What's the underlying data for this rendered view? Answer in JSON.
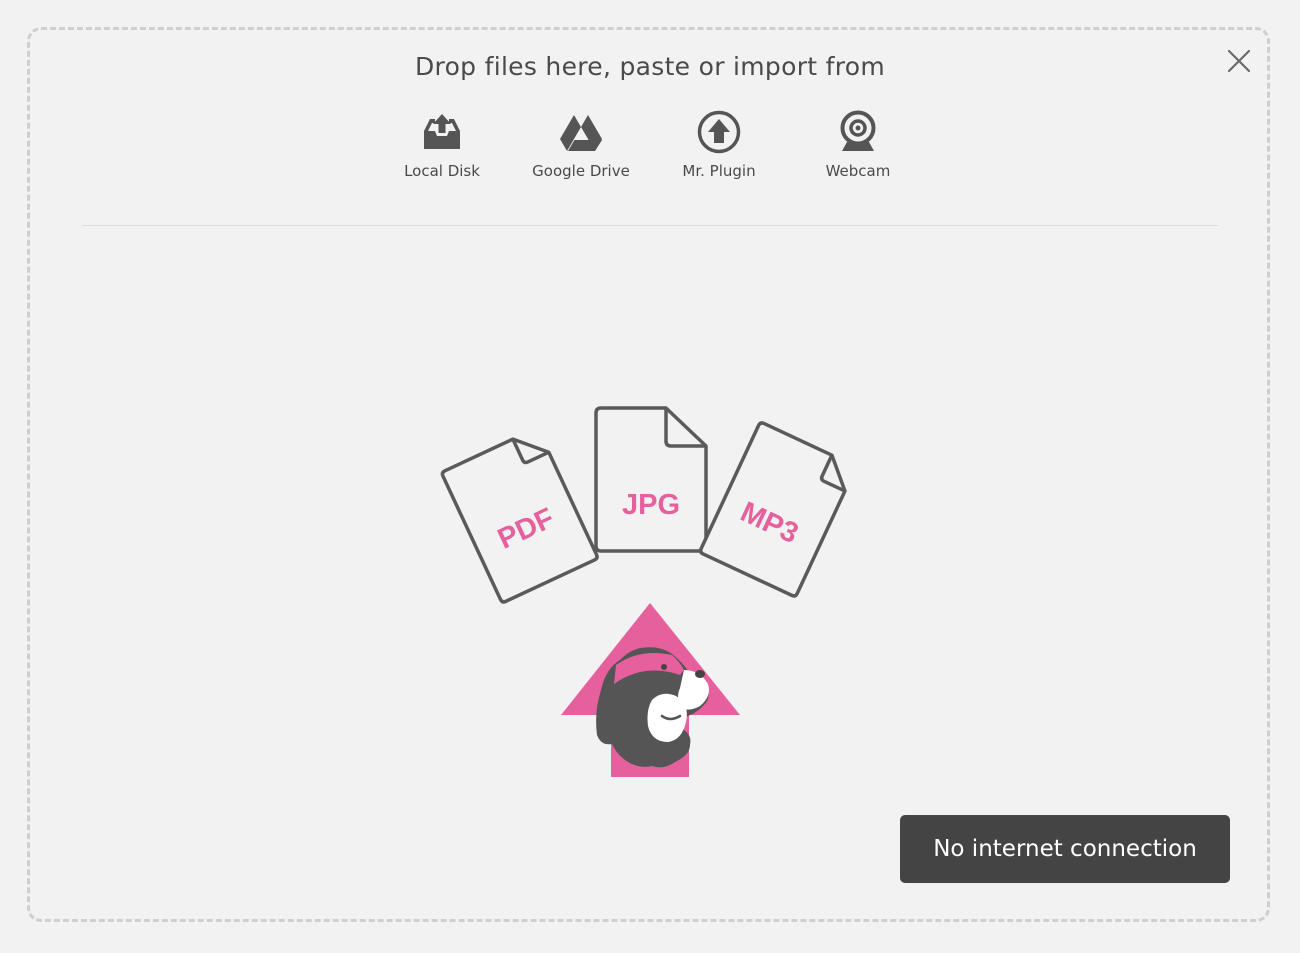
{
  "header": {
    "title": "Drop files here, paste or import from"
  },
  "sources": [
    {
      "label": "Local Disk",
      "icon": "inbox-upload-icon"
    },
    {
      "label": "Google Drive",
      "icon": "google-drive-icon"
    },
    {
      "label": "Mr. Plugin",
      "icon": "upload-circle-icon"
    },
    {
      "label": "Webcam",
      "icon": "webcam-icon"
    }
  ],
  "illustration": {
    "files": [
      "PDF",
      "JPG",
      "MP3"
    ],
    "accent_color": "#e5609d"
  },
  "toast": {
    "message": "No internet connection"
  },
  "close": {
    "icon": "close-icon"
  }
}
